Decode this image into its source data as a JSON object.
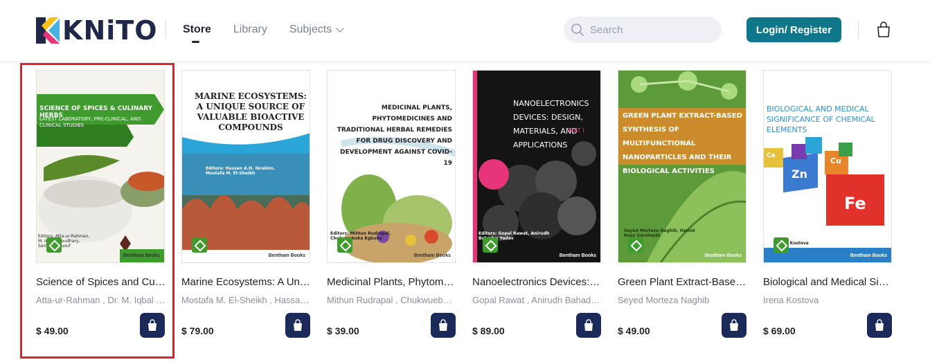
{
  "header": {
    "logo_text": "KNiTO",
    "nav": [
      {
        "label": "Store",
        "active": true
      },
      {
        "label": "Library",
        "active": false
      },
      {
        "label": "Subjects",
        "active": false
      }
    ],
    "search_placeholder": "Search",
    "login_label": "Login/ Register"
  },
  "colors": {
    "accent": "#10768a",
    "button_dark": "#1b2a59",
    "highlight": "#d9262c"
  },
  "books": [
    {
      "title": "Science of Spices and Culinary Herbs",
      "authors": "Atta-ur-Rahman , Dr. M. Iqbal Choudhary",
      "price": "$ 49.00",
      "cover_title": "SCIENCE OF SPICES & CULINARY HERBS",
      "cover_subtitle": "LATEST LABORATORY, PRE-CLINICAL, AND CLINICAL STUDIES",
      "cover_editors": "Editors: Atta-ur-Rahman, M. Iqbal Choudhary, Sammer Yousuf",
      "publisher": "Bentham Books"
    },
    {
      "title": "Marine Ecosystems: A Unique Source of Valuable Bioactive Compounds",
      "authors": "Mostafa M. El-Sheikh , Hassan A.H. Ibrahim",
      "price": "$ 79.00",
      "cover_title": "MARINE ECOSYSTEMS: A UNIQUE SOURCE OF VALUABLE BIOACTIVE COMPOUNDS",
      "cover_editors": "Editors: Hassan A.H. Ibrahim, Mostafa M. El-Sheikh",
      "publisher": "Bentham Books"
    },
    {
      "title": "Medicinal Plants, Phytomedicines and Traditional Herbal Remedies",
      "authors": "Mithun Rudrapal , Chukwuebuka Egbuna",
      "price": "$ 39.00",
      "cover_title": "MEDICINAL PLANTS, PHYTOMEDICINES AND TRADITIONAL HERBAL REMEDIES FOR DRUG DISCOVERY AND DEVELOPMENT AGAINST COVID-19",
      "cover_editors": "Editors: Mithun Rudrapal, Chukwuebuka Egbuna",
      "publisher": "Bentham Books"
    },
    {
      "title": "Nanoelectronics Devices: Design, Materials, and Applications",
      "authors": "Gopal Rawat , Anirudh Bahadur Yadav",
      "price": "$ 89.00",
      "cover_title": "NANOELECTRONICS DEVICES: DESIGN, MATERIALS, AND APPLICATIONS",
      "cover_part": "PART I",
      "cover_editors": "Editors: Gopal Rawat, Anirudh Bahadur Yadav",
      "publisher": "Bentham Books"
    },
    {
      "title": "Green Plant Extract-Based Synthesis of Multifunctional Nanoparticles",
      "authors": "Seyed Morteza Naghib",
      "price": "$ 49.00",
      "cover_title": "GREEN PLANT EXTRACT-BASED SYNTHESIS OF MULTIFUNCTIONAL NANOPARTICLES AND THEIR BIOLOGICAL ACTIVITIES",
      "cover_editors": "Seyed Morteza Naghib, Hamid Reza Garshasbi",
      "publisher": "Bentham Books"
    },
    {
      "title": "Biological and Medical Significance of Chemical Elements",
      "authors": "Irena Kostova",
      "price": "$ 69.00",
      "cover_title": "BIOLOGICAL AND MEDICAL SIGNIFICANCE OF CHEMICAL ELEMENTS",
      "cover_editors": "Irena Kostova",
      "publisher": "Bentham Books",
      "cover_elements": [
        "Fe",
        "Zn",
        "Cu",
        "Ca",
        "Fe"
      ]
    }
  ]
}
